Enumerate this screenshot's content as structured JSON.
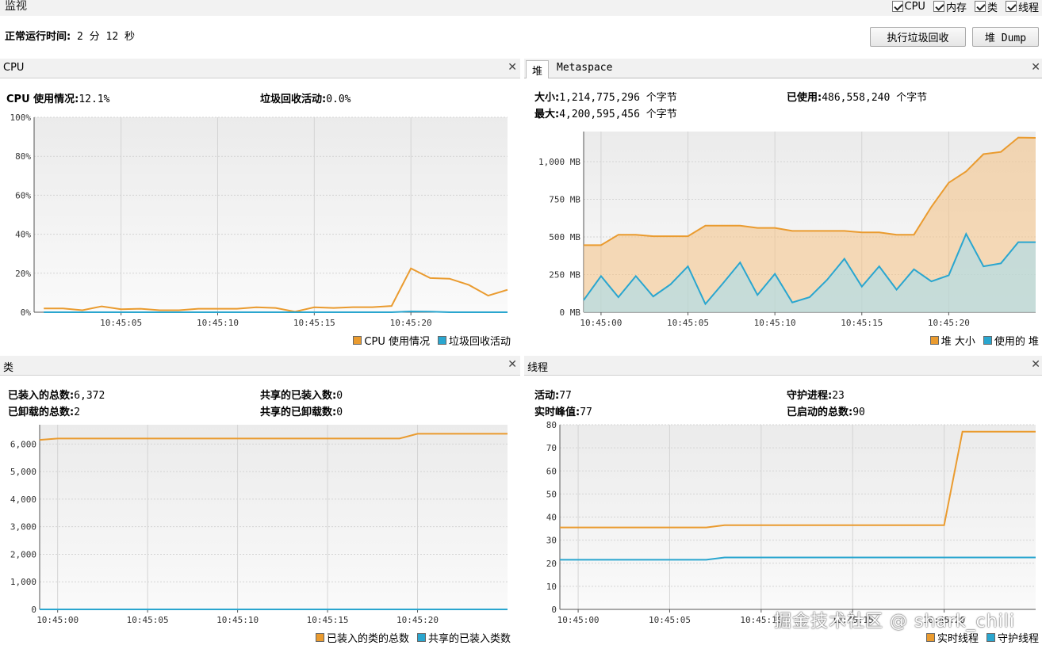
{
  "window": {
    "title": "监视"
  },
  "toggles": [
    {
      "label": "CPU"
    },
    {
      "label": "内存"
    },
    {
      "label": "类"
    },
    {
      "label": "线程"
    }
  ],
  "uptime": {
    "label": "正常运行时间:",
    "value": "2 分 12 秒"
  },
  "buttons": {
    "gc": "执行垃圾回收",
    "dump": "堆 Dump"
  },
  "colors": {
    "orange": "#ea9b2f",
    "blue": "#2aa6cf",
    "orange_fill": "#f4c48c",
    "blue_fill": "#a7ddef"
  },
  "cpu": {
    "title": "CPU",
    "usage_label": "CPU 使用情况:",
    "usage_value": "12.1%",
    "gc_label": "垃圾回收活动:",
    "gc_value": "0.0%",
    "legend": [
      "CPU 使用情况",
      "垃圾回收活动"
    ]
  },
  "memory": {
    "tabs": [
      "堆",
      "Metaspace"
    ],
    "size_label": "大小:",
    "size_value": "1,214,775,296 个字节",
    "max_label": "最大:",
    "max_value": "4,200,595,456 个字节",
    "used_label": "已使用:",
    "used_value": "486,558,240 个字节",
    "legend": [
      "堆 大小",
      "使用的 堆"
    ]
  },
  "classes": {
    "title": "类",
    "loaded_label": "已装入的总数:",
    "loaded_value": "6,372",
    "unloaded_label": "已卸载的总数:",
    "unloaded_value": "2",
    "shared_loaded_label": "共享的已装入数:",
    "shared_loaded_value": "0",
    "shared_unloaded_label": "共享的已卸载数:",
    "shared_unloaded_value": "0",
    "legend": [
      "已装入的类的总数",
      "共享的已装入类数"
    ]
  },
  "threads": {
    "title": "线程",
    "live_label": "活动:",
    "live_value": "77",
    "peak_label": "实时峰值:",
    "peak_value": "77",
    "daemon_label": "守护进程:",
    "daemon_value": "23",
    "started_label": "已启动的总数:",
    "started_value": "90",
    "legend": [
      "实时线程",
      "守护线程"
    ]
  },
  "watermark": "掘金技术社区 @ shark_chili",
  "chart_data": [
    {
      "id": "cpu",
      "type": "line",
      "x": [
        "10:45:01",
        "10:45:02",
        "10:45:03",
        "10:45:04",
        "10:45:05",
        "10:45:06",
        "10:45:07",
        "10:45:08",
        "10:45:09",
        "10:45:10",
        "10:45:11",
        "10:45:12",
        "10:45:13",
        "10:45:14",
        "10:45:15",
        "10:45:16",
        "10:45:17",
        "10:45:18",
        "10:45:19",
        "10:45:20",
        "10:45:21",
        "10:45:22",
        "10:45:23",
        "10:45:24",
        "10:45:25"
      ],
      "x_ticks": [
        "10:45:05",
        "10:45:10",
        "10:45:15",
        "10:45:20"
      ],
      "y_ticks": [
        "0%",
        "20%",
        "40%",
        "60%",
        "80%",
        "100%"
      ],
      "ylim": [
        0,
        100
      ],
      "series": [
        {
          "name": "CPU 使用情况",
          "color": "orange",
          "values": [
            1.9,
            1.9,
            1.0,
            3.0,
            1.5,
            1.8,
            1.0,
            1.0,
            1.8,
            1.8,
            1.8,
            2.5,
            2.2,
            0.3,
            2.5,
            2.2,
            2.6,
            2.6,
            3.2,
            22.5,
            17.5,
            17.2,
            14.0,
            8.5,
            11.5
          ]
        },
        {
          "name": "垃圾回收活动",
          "color": "blue",
          "values": [
            0,
            0,
            0,
            0,
            0,
            0,
            0,
            0,
            0,
            0,
            0,
            0,
            0,
            0,
            0,
            0,
            0,
            0,
            0,
            0.4,
            0.3,
            0,
            0,
            0,
            0
          ]
        }
      ]
    },
    {
      "id": "heap",
      "type": "area",
      "x": [
        "10:44:59",
        "10:45:00",
        "10:45:01",
        "10:45:02",
        "10:45:03",
        "10:45:04",
        "10:45:05",
        "10:45:06",
        "10:45:07",
        "10:45:08",
        "10:45:09",
        "10:45:10",
        "10:45:11",
        "10:45:12",
        "10:45:13",
        "10:45:14",
        "10:45:15",
        "10:45:16",
        "10:45:17",
        "10:45:18",
        "10:45:19",
        "10:45:20",
        "10:45:21",
        "10:45:22",
        "10:45:23",
        "10:45:24",
        "10:45:25"
      ],
      "x_ticks": [
        "10:45:00",
        "10:45:05",
        "10:45:10",
        "10:45:15",
        "10:45:20"
      ],
      "y_ticks": [
        "0 MB",
        "250 MB",
        "500 MB",
        "750 MB",
        "1,000 MB"
      ],
      "ylim": [
        0,
        1200
      ],
      "series": [
        {
          "name": "堆 大小",
          "color": "orange",
          "values": [
            445,
            445,
            515,
            515,
            505,
            505,
            505,
            575,
            575,
            575,
            560,
            560,
            540,
            540,
            540,
            540,
            530,
            530,
            515,
            515,
            700,
            860,
            935,
            1050,
            1065,
            1160,
            1158
          ]
        },
        {
          "name": "使用的 堆",
          "color": "blue",
          "values": [
            80,
            240,
            100,
            240,
            105,
            185,
            305,
            55,
            190,
            330,
            115,
            255,
            65,
            100,
            215,
            355,
            170,
            305,
            150,
            285,
            205,
            245,
            520,
            305,
            325,
            465,
            465
          ]
        }
      ]
    },
    {
      "id": "classes",
      "type": "line",
      "x": [
        "10:44:59",
        "10:45:00",
        "10:45:05",
        "10:45:10",
        "10:45:15",
        "10:45:19",
        "10:45:20",
        "10:45:25"
      ],
      "x_ticks": [
        "10:45:00",
        "10:45:05",
        "10:45:10",
        "10:45:15",
        "10:45:20"
      ],
      "y_ticks": [
        "0",
        "1,000",
        "2,000",
        "3,000",
        "4,000",
        "5,000",
        "6,000"
      ],
      "ylim": [
        0,
        6700
      ],
      "series": [
        {
          "name": "已装入的类的总数",
          "color": "orange",
          "values": [
            6150,
            6200,
            6200,
            6200,
            6200,
            6200,
            6372,
            6372
          ]
        },
        {
          "name": "共享的已装入类数",
          "color": "blue",
          "values": [
            0,
            0,
            0,
            0,
            0,
            0,
            0,
            0
          ]
        }
      ]
    },
    {
      "id": "threads",
      "type": "line",
      "x": [
        "10:44:59",
        "10:45:00",
        "10:45:05",
        "10:45:07",
        "10:45:08",
        "10:45:20",
        "10:45:21",
        "10:45:25"
      ],
      "x_ticks": [
        "10:45:00",
        "10:45:05",
        "10:45:10",
        "10:45:15",
        "10:45:20"
      ],
      "y_ticks": [
        "0",
        "10",
        "20",
        "30",
        "40",
        "50",
        "60",
        "70",
        "80"
      ],
      "ylim": [
        0,
        80
      ],
      "series": [
        {
          "name": "实时线程",
          "color": "orange",
          "values": [
            35.5,
            35.5,
            35.5,
            35.5,
            36.5,
            36.5,
            77,
            77
          ]
        },
        {
          "name": "守护线程",
          "color": "blue",
          "values": [
            21.5,
            21.5,
            21.5,
            21.5,
            22.5,
            22.5,
            22.5,
            22.5
          ]
        }
      ]
    }
  ]
}
